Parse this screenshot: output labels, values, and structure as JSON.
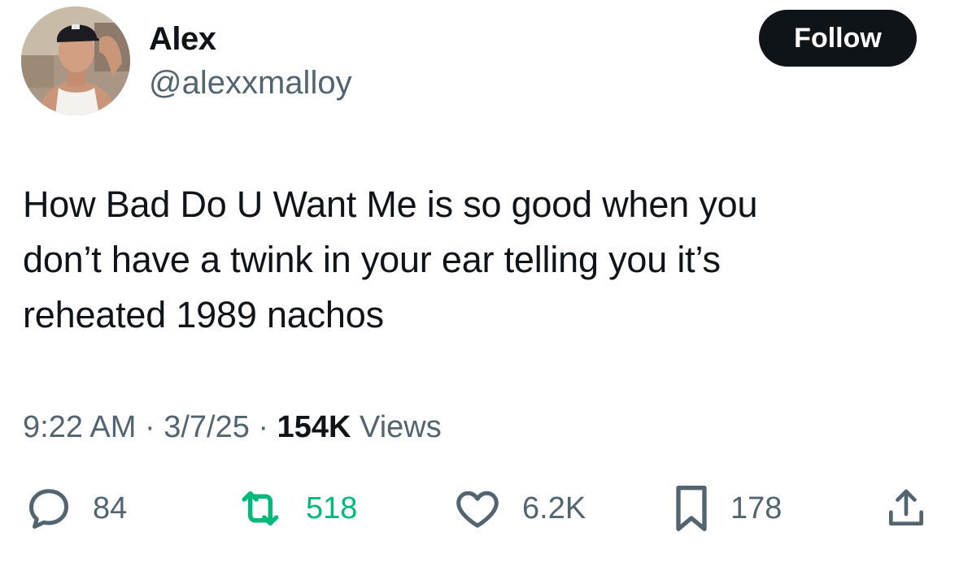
{
  "user": {
    "name": "Alex",
    "handle": "@alexxmalloy"
  },
  "follow_button": {
    "label": "Follow",
    "bg": "#0f1419",
    "text_color": "#ffffff"
  },
  "tweet": {
    "lines": [
      "How Bad Do U Want Me is so good when you",
      "don’t have a twink in your ear telling you it’s",
      "reheated 1989 nachos"
    ]
  },
  "meta": {
    "time": "9:22 AM",
    "sep1": " · ",
    "date": "3/7/25",
    "sep2": " · ",
    "views_count": "154K",
    "views_label": " Views"
  },
  "actions": {
    "reply": {
      "icon": "reply-icon",
      "count": "84"
    },
    "retweet": {
      "icon": "retweet-icon",
      "count": "518",
      "color": "#00ba7c"
    },
    "like": {
      "icon": "heart-icon",
      "count": "6.2K"
    },
    "bookmark": {
      "icon": "bookmark-icon",
      "count": "178"
    },
    "share": {
      "icon": "share-icon"
    }
  },
  "colors": {
    "text_primary": "#0f1419",
    "text_secondary": "#536471",
    "retweet_active": "#00ba7c"
  }
}
